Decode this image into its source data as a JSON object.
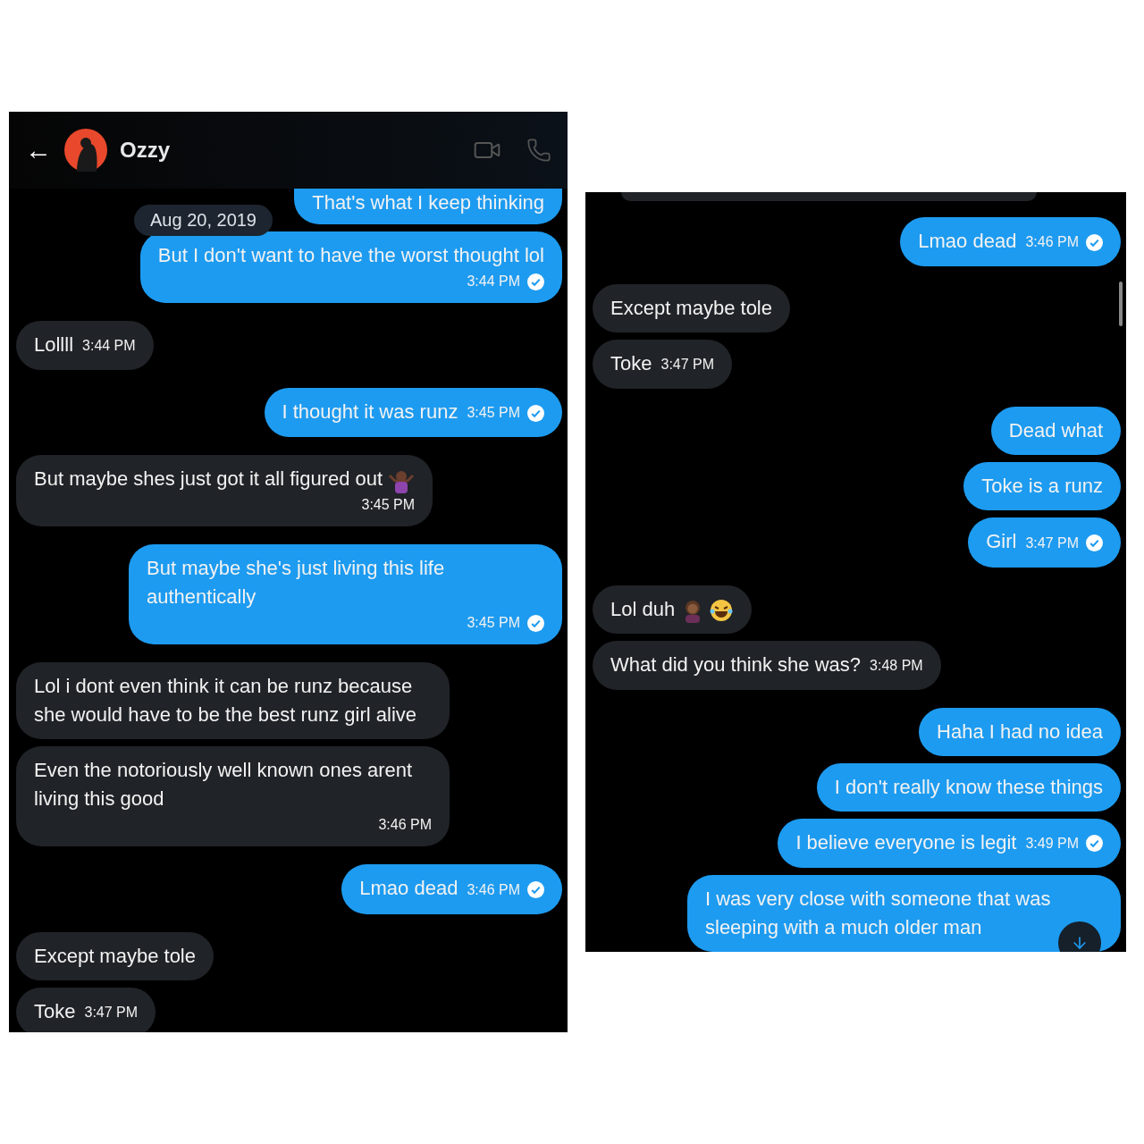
{
  "left_screen": {
    "header": {
      "back": "←",
      "name": "Ozzy"
    },
    "date_divider": "Aug 20, 2019",
    "messages": [
      {
        "kind": "sent",
        "text": "That's what I keep thinking",
        "clipped": true
      },
      {
        "kind": "sent",
        "text": "But I don't want to have the worst thought lol",
        "time": "3:44 PM",
        "read": true
      },
      {
        "kind": "received",
        "text": "Lollll",
        "time": "3:44 PM"
      },
      {
        "kind": "sent",
        "text": "I thought it was runz",
        "time": "3:45 PM",
        "read": true
      },
      {
        "kind": "received",
        "text": "But maybe shes just got it all figured out",
        "emojis": [
          {
            "kind": "shrug"
          }
        ],
        "time": "3:45 PM"
      },
      {
        "kind": "sent",
        "text": "But maybe she's just living this life authentically",
        "time": "3:45 PM",
        "read": true
      },
      {
        "kind": "received",
        "text": "Lol i dont even think it can be runz because she would have to be the best runz girl alive"
      },
      {
        "kind": "received",
        "text": "Even the notoriously well known ones arent living this good",
        "time": "3:46 PM"
      },
      {
        "kind": "sent",
        "text": "Lmao dead",
        "time": "3:46 PM",
        "read": true
      },
      {
        "kind": "received",
        "text": "Except maybe tole"
      },
      {
        "kind": "received",
        "text": "Toke",
        "time": "3:47 PM"
      }
    ]
  },
  "right_screen": {
    "messages": [
      {
        "kind": "sent",
        "text": "Lmao dead",
        "time": "3:46 PM",
        "read": true
      },
      {
        "kind": "received",
        "text": "Except maybe tole"
      },
      {
        "kind": "received",
        "text": "Toke",
        "time": "3:47 PM"
      },
      {
        "kind": "sent",
        "text": "Dead what"
      },
      {
        "kind": "sent",
        "text": "Toke is a runz"
      },
      {
        "kind": "sent",
        "text": "Girl",
        "time": "3:47 PM",
        "read": true
      },
      {
        "kind": "received",
        "text": "Lol duh",
        "emojis": [
          {
            "kind": "facepalm"
          },
          {
            "kind": "laugh"
          }
        ]
      },
      {
        "kind": "received",
        "text": "What did you think she was?",
        "time": "3:48 PM"
      },
      {
        "kind": "sent",
        "text": "Haha I had no idea"
      },
      {
        "kind": "sent",
        "text": "I don't really know these things"
      },
      {
        "kind": "sent",
        "text": "I believe everyone is legit",
        "time": "3:49 PM",
        "read": true
      },
      {
        "kind": "sent",
        "text": "I was very close with someone that was sleeping with a much older man"
      }
    ]
  }
}
